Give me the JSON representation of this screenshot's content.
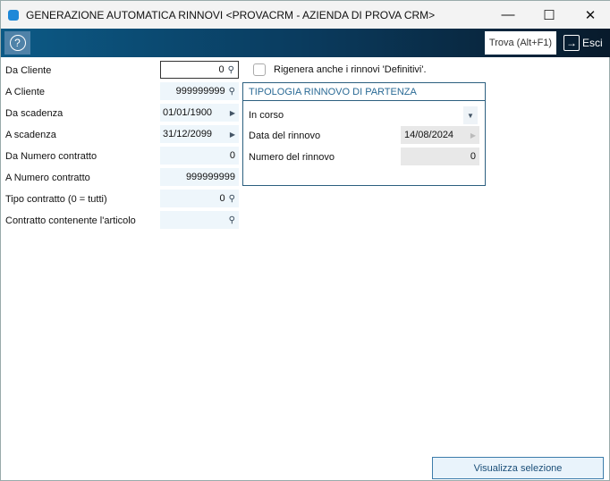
{
  "window": {
    "title": "GENERAZIONE AUTOMATICA RINNOVI <PROVACRM - AZIENDA DI PROVA CRM>",
    "minimize": "—",
    "maximize": "☐",
    "close": "✕"
  },
  "toolbar": {
    "help": "?",
    "find": "Trova (Alt+F1)",
    "exit": "Esci"
  },
  "fields": [
    {
      "label": "Da Cliente",
      "value": "0"
    },
    {
      "label": "A Cliente",
      "value": "999999999"
    },
    {
      "label": "Da scadenza",
      "value": "01/01/1900"
    },
    {
      "label": "A scadenza",
      "value": "31/12/2099"
    },
    {
      "label": "Da Numero contratto",
      "value": "0"
    },
    {
      "label": "A Numero contratto",
      "value": "999999999"
    },
    {
      "label": "Tipo contratto (0 = tutti)",
      "value": "0"
    },
    {
      "label": "Contratto contenente l'articolo",
      "value": ""
    }
  ],
  "regen_checkbox": {
    "label": "Rigenera anche i rinnovi 'Definitivi'.",
    "checked": false
  },
  "group": {
    "title": "TIPOLOGIA RINNOVO DI PARTENZA",
    "type": "In corso",
    "date_label": "Data del rinnovo",
    "date": "14/08/2024",
    "number_label": "Numero del rinnovo",
    "number": "0"
  },
  "show_button": "Visualizza selezione"
}
